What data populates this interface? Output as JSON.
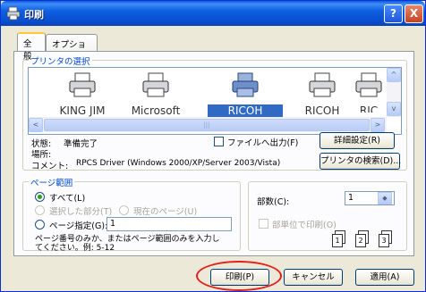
{
  "window": {
    "title": "印刷",
    "help_button": "?",
    "close_button": "X"
  },
  "tabs": [
    {
      "label": "全般",
      "active": true
    },
    {
      "label": "オプション",
      "active": false
    }
  ],
  "printer_select": {
    "legend": "プリンタの選択",
    "printers": [
      {
        "name": "KING JIM",
        "selected": false
      },
      {
        "name": "Microsoft",
        "selected": false
      },
      {
        "name": "RICOH",
        "selected": true
      },
      {
        "name": "RICOH",
        "selected": false
      },
      {
        "name": "RIC",
        "selected": false
      }
    ],
    "scroll_left": "<",
    "scroll_right": ">",
    "scroll_up": "^",
    "scroll_down": "v",
    "thumb_grip": "|||"
  },
  "status": {
    "status_label": "状態:",
    "status_value": "準備完了",
    "location_label": "場所:",
    "location_value": "",
    "comment_label": "コメント:",
    "comment_value": "RPCS Driver (Windows 2000/XP/Server 2003/Vista)",
    "print_to_file_label": "ファイルへ出力(F)",
    "detail_button": "詳細設定(R)",
    "find_printer_button": "プリンタの検索(D)..."
  },
  "page_range": {
    "legend": "ページ範囲",
    "all_label": "すべて(L)",
    "selection_label": "選択した部分(T)",
    "current_page_label": "現在のページ(U)",
    "pages_label": "ページ指定(G):",
    "pages_value": "1",
    "hint_line1": "ページ番号のみか、またはページ範囲のみを入力し",
    "hint_line2": "てください。例: 5-12"
  },
  "copies": {
    "count_label": "部数(C):",
    "count_value": "1",
    "spin": "◆",
    "collate_label": "部単位で印刷(O)",
    "collate_pages": [
      "1",
      "1",
      "2",
      "2",
      "3",
      "3"
    ]
  },
  "footer": {
    "print_button": "印刷(P)",
    "cancel_button": "キャンセル",
    "apply_button": "適用(A)"
  },
  "colors": {
    "title_blue": "#0a4fd0",
    "selection": "#316ac5",
    "highlight_ellipse": "#e3201b"
  }
}
